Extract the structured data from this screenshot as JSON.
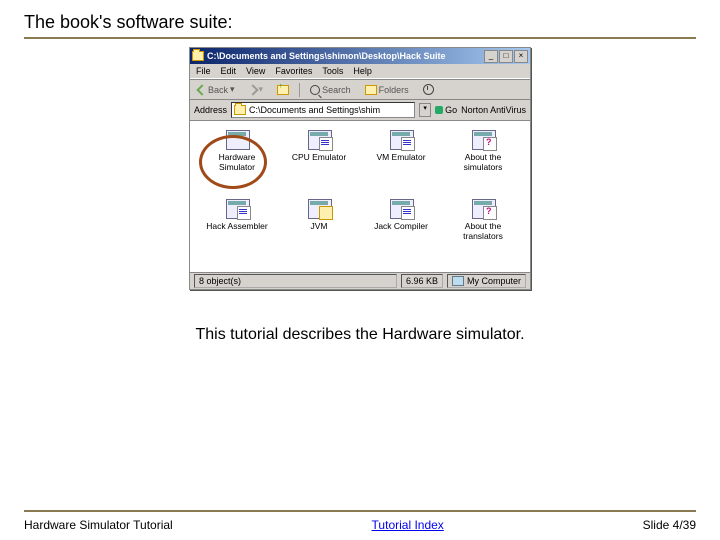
{
  "slide": {
    "title": "The book's software suite:",
    "caption": "This tutorial describes the Hardware simulator."
  },
  "explorer": {
    "window_title": "C:\\Documents and Settings\\shimon\\Desktop\\Hack Suite",
    "menu": [
      "File",
      "Edit",
      "View",
      "Favorites",
      "Tools",
      "Help"
    ],
    "toolbar": {
      "back_label": "Back",
      "search_label": "Search",
      "folders_label": "Folders"
    },
    "address": {
      "label": "Address",
      "value": "C:\\Documents and Settings\\shim",
      "go_label": "Go",
      "extra": "Norton AntiVirus"
    },
    "items": [
      {
        "label": "Hardware Simulator"
      },
      {
        "label": "CPU Emulator"
      },
      {
        "label": "VM Emulator"
      },
      {
        "label": "About the simulators"
      },
      {
        "label": "Hack Assembler"
      },
      {
        "label": "JVM"
      },
      {
        "label": "Jack Compiler"
      },
      {
        "label": "About the translators"
      }
    ],
    "status": {
      "objects": "8 object(s)",
      "size": "6.96 KB",
      "location": "My Computer"
    }
  },
  "footer": {
    "left": "Hardware Simulator Tutorial",
    "link": "Tutorial Index",
    "right": "Slide 4/39"
  }
}
